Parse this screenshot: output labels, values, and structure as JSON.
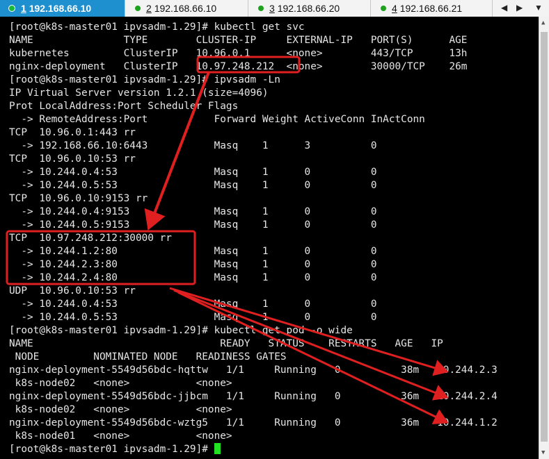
{
  "tabs": [
    {
      "num": "1",
      "host": "192.168.66.10",
      "active": true
    },
    {
      "num": "2",
      "host": "192.168.66.10",
      "active": false
    },
    {
      "num": "3",
      "host": "192.168.66.20",
      "active": false
    },
    {
      "num": "4",
      "host": "192.168.66.21",
      "active": false
    }
  ],
  "nav": {
    "prev": "◀",
    "next": "▶",
    "menu": "▼"
  },
  "terminal": {
    "lines": [
      "[root@k8s-master01 ipvsadm-1.29]# kubectl get svc",
      "NAME               TYPE        CLUSTER-IP     EXTERNAL-IP   PORT(S)      AGE",
      "kubernetes         ClusterIP   10.96.0.1      <none>        443/TCP      13h",
      "nginx-deployment   ClusterIP   10.97.248.212  <none>        30000/TCP    26m",
      "[root@k8s-master01 ipvsadm-1.29]# ipvsadm -Ln",
      "IP Virtual Server version 1.2.1 (size=4096)",
      "Prot LocalAddress:Port Scheduler Flags",
      "  -> RemoteAddress:Port           Forward Weight ActiveConn InActConn",
      "TCP  10.96.0.1:443 rr",
      "  -> 192.168.66.10:6443           Masq    1      3          0",
      "TCP  10.96.0.10:53 rr",
      "  -> 10.244.0.4:53                Masq    1      0          0",
      "  -> 10.244.0.5:53                Masq    1      0          0",
      "TCP  10.96.0.10:9153 rr",
      "  -> 10.244.0.4:9153              Masq    1      0          0",
      "  -> 10.244.0.5:9153              Masq    1      0          0",
      "TCP  10.97.248.212:30000 rr",
      "  -> 10.244.1.2:80                Masq    1      0          0",
      "  -> 10.244.2.3:80                Masq    1      0          0",
      "  -> 10.244.2.4:80                Masq    1      0          0",
      "UDP  10.96.0.10:53 rr",
      "  -> 10.244.0.4:53                Masq    1      0          0",
      "  -> 10.244.0.5:53                Masq    1      0          0",
      "[root@k8s-master01 ipvsadm-1.29]# kubectl get pod -o wide",
      "NAME                               READY   STATUS    RESTARTS   AGE   IP",
      " NODE         NOMINATED NODE   READINESS GATES",
      "nginx-deployment-5549d56bdc-hqttw   1/1     Running   0          38m   10.244.2.3",
      " k8s-node02   <none>           <none>",
      "nginx-deployment-5549d56bdc-jjbcm   1/1     Running   0          36m   10.244.2.4",
      " k8s-node02   <none>           <none>",
      "nginx-deployment-5549d56bdc-wztg5   1/1     Running   0          36m   10.244.1.2",
      " k8s-node01   <none>           <none>"
    ],
    "prompt": "[root@k8s-master01 ipvsadm-1.29]# "
  },
  "colors": {
    "annotation": "#e02020",
    "cursor": "#22e022",
    "active_tab": "#1e8fcf"
  }
}
